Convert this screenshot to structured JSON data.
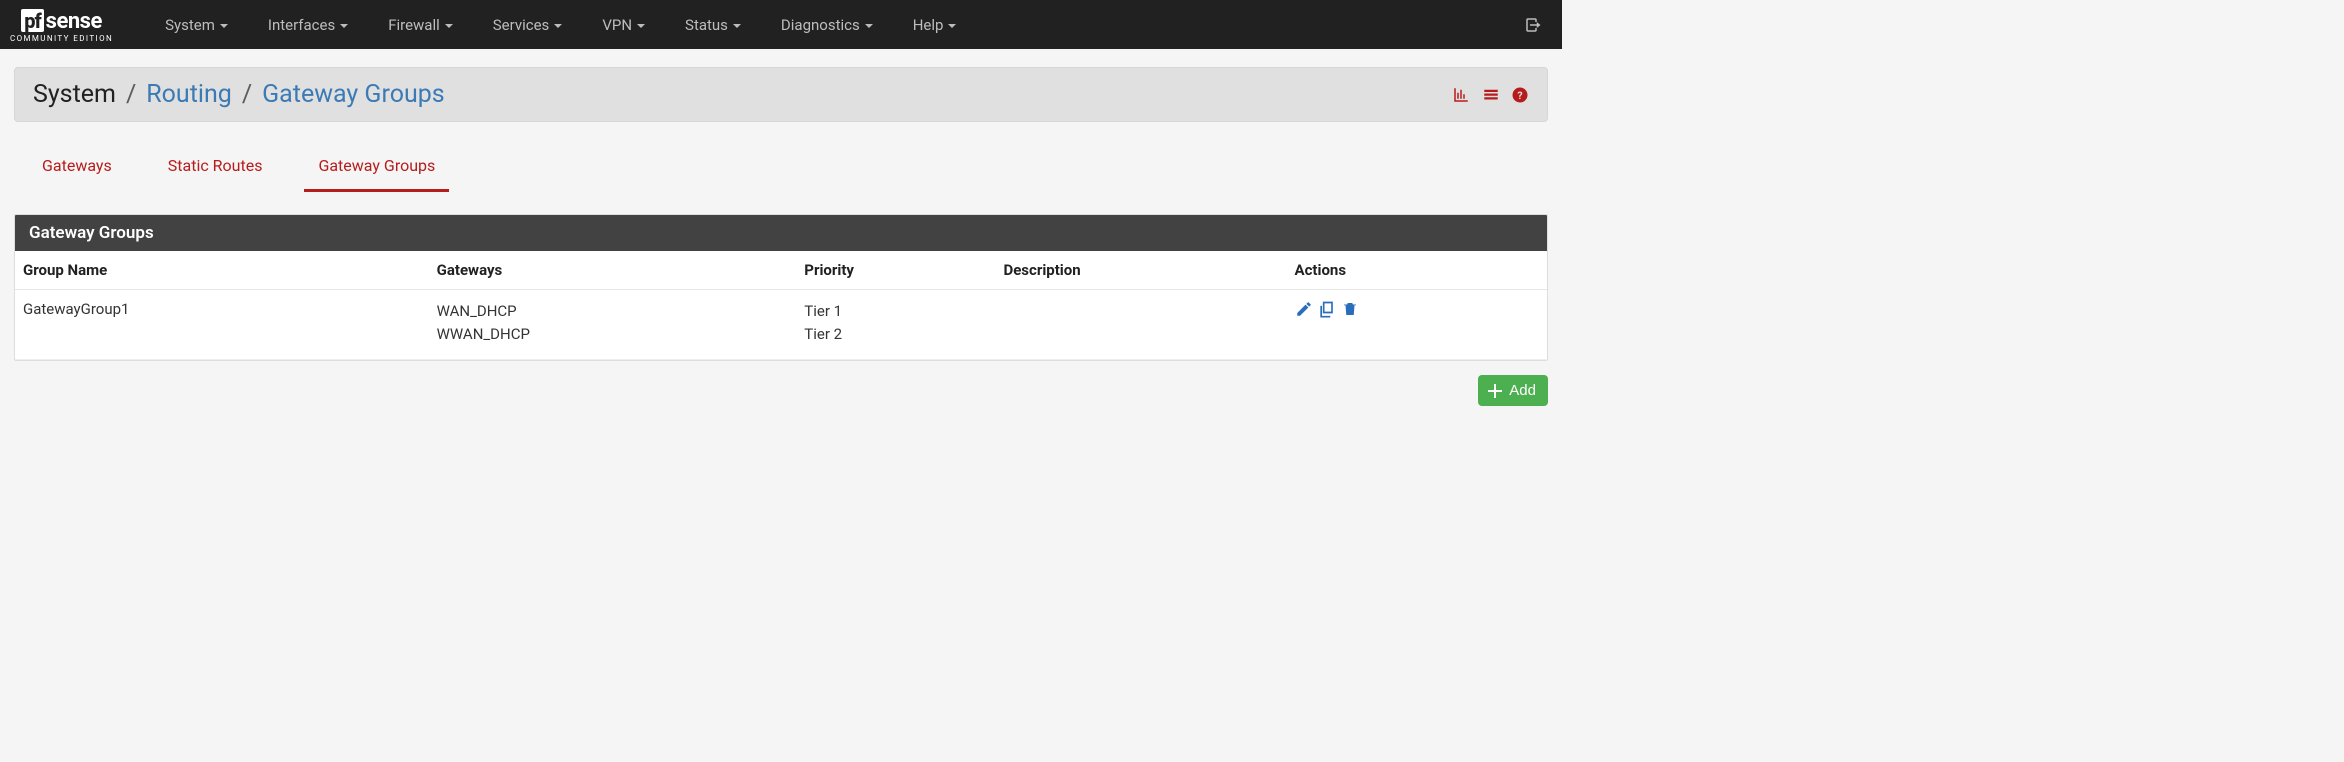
{
  "brand": {
    "pf": "pf",
    "sense": "sense",
    "tagline": "COMMUNITY EDITION"
  },
  "nav": {
    "items": [
      {
        "label": "System"
      },
      {
        "label": "Interfaces"
      },
      {
        "label": "Firewall"
      },
      {
        "label": "Services"
      },
      {
        "label": "VPN"
      },
      {
        "label": "Status"
      },
      {
        "label": "Diagnostics"
      },
      {
        "label": "Help"
      }
    ]
  },
  "breadcrumb": {
    "root": "System",
    "mid": "Routing",
    "leaf": "Gateway Groups"
  },
  "tabs": [
    {
      "label": "Gateways",
      "active": false
    },
    {
      "label": "Static Routes",
      "active": false
    },
    {
      "label": "Gateway Groups",
      "active": true
    }
  ],
  "panel": {
    "title": "Gateway Groups"
  },
  "columns": {
    "name": "Group Name",
    "gateways": "Gateways",
    "priority": "Priority",
    "description": "Description",
    "actions": "Actions"
  },
  "rows": [
    {
      "name": "GatewayGroup1",
      "gateways": [
        "WAN_DHCP",
        "WWAN_DHCP"
      ],
      "priority": [
        "Tier 1",
        "Tier 2"
      ],
      "description": ""
    }
  ],
  "buttons": {
    "add": "Add"
  }
}
